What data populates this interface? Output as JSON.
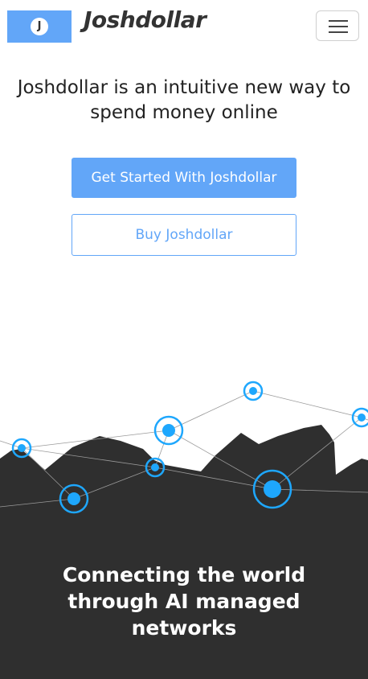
{
  "header": {
    "logo_letter": "J",
    "brand": "Joshdollar",
    "menu_toggle": "menu-toggle"
  },
  "hero": {
    "title": "Joshdollar is an intuitive new way to spend money online",
    "primary_button": "Get Started With Joshdollar",
    "secondary_button": "Buy Joshdollar"
  },
  "network_section": {
    "tagline": "Connecting the world through AI managed networks"
  },
  "colors": {
    "accent": "#62a6f8",
    "node": "#1ea7fd",
    "dark": "#2f2f2f"
  }
}
